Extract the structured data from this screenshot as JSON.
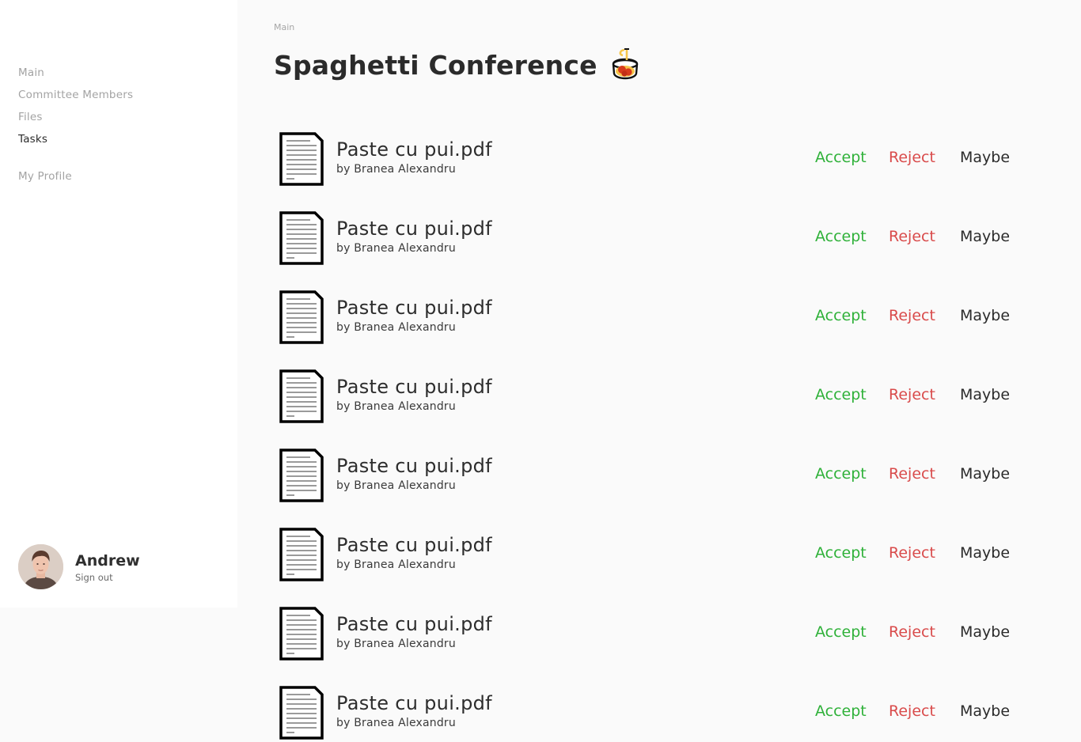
{
  "sidebar": {
    "nav": [
      {
        "label": "Main",
        "active": false
      },
      {
        "label": "Committee Members",
        "active": false
      },
      {
        "label": "Files",
        "active": false
      },
      {
        "label": "Tasks",
        "active": true
      }
    ],
    "profile_label": "My Profile",
    "user": {
      "name": "Andrew",
      "sign_out": "Sign out"
    }
  },
  "header": {
    "breadcrumb": "Main",
    "title": "Spaghetti Conference",
    "title_icon": "spaghetti-icon"
  },
  "actions": {
    "accept": "Accept",
    "reject": "Reject",
    "maybe": "Maybe"
  },
  "colors": {
    "accept": "#2fb139",
    "reject": "#d94b4b",
    "maybe": "#2b2b2b"
  },
  "files": [
    {
      "name": "Paste cu pui.pdf",
      "author": "by Branea Alexandru"
    },
    {
      "name": "Paste cu pui.pdf",
      "author": "by Branea Alexandru"
    },
    {
      "name": "Paste cu pui.pdf",
      "author": "by Branea Alexandru"
    },
    {
      "name": "Paste cu pui.pdf",
      "author": "by Branea Alexandru"
    },
    {
      "name": "Paste cu pui.pdf",
      "author": "by Branea Alexandru"
    },
    {
      "name": "Paste cu pui.pdf",
      "author": "by Branea Alexandru"
    },
    {
      "name": "Paste cu pui.pdf",
      "author": "by Branea Alexandru"
    },
    {
      "name": "Paste cu pui.pdf",
      "author": "by Branea Alexandru"
    }
  ]
}
